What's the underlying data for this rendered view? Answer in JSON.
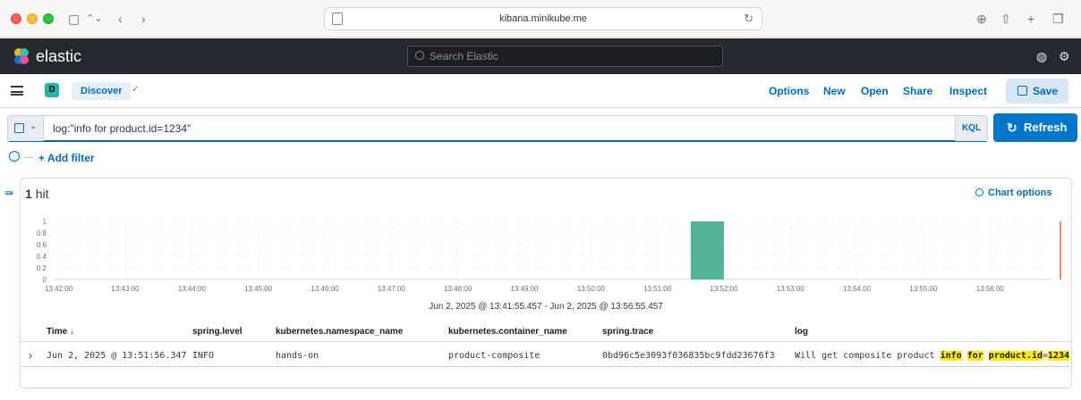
{
  "browser": {
    "url": "kibana.minikube.me",
    "icons": [
      "sidebar-icon",
      "tab-overview-icon",
      "back-icon",
      "forward-icon",
      "site-settings-icon",
      "reload-icon",
      "download-icon",
      "share-icon",
      "new-tab-icon",
      "tabs-icon"
    ]
  },
  "header": {
    "brand": "elastic",
    "search_placeholder": "Search Elastic",
    "icons": [
      "help-icon",
      "user-menu-icon"
    ]
  },
  "appbar": {
    "space_initial": "D",
    "breadcrumb": "Discover",
    "menu": [
      "Options",
      "New",
      "Open",
      "Share",
      "Inspect"
    ],
    "save_label": "Save"
  },
  "query": {
    "text": "log:\"info for product.id=1234\"",
    "language": "KQL",
    "refresh_label": "Refresh",
    "add_filter_label": "+ Add filter"
  },
  "results": {
    "hit_count": "1",
    "hit_label": "hit",
    "chart_options_label": "Chart options",
    "time_range": "Jun 2, 2025 @ 13:41:55.457 - Jun 2, 2025 @ 13:56:55.457"
  },
  "chart_data": {
    "type": "bar",
    "title": "",
    "xlabel": "Jun 2, 2025 @ 13:41:55.457 - Jun 2, 2025 @ 13:56:55.457",
    "ylabel": "",
    "x_ticks": [
      "13:42:00",
      "13:43:00",
      "13:44:00",
      "13:45:00",
      "13:46:00",
      "13:47:00",
      "13:48:00",
      "13:49:00",
      "13:50:00",
      "13:51:00",
      "13:52:00",
      "13:53:00",
      "13:54:00",
      "13:55:00",
      "13:56:00"
    ],
    "y_ticks": [
      "0",
      "0.2",
      "0.4",
      "0.6",
      "0.8",
      "1"
    ],
    "ylim": [
      0,
      1
    ],
    "bars": [
      {
        "start": "13:51:30",
        "end": "13:52:00",
        "value": 1
      }
    ],
    "bar_color": "#54b399",
    "now_marker_color": "#e7664c",
    "grid": true
  },
  "table": {
    "columns": [
      "Time",
      "spring.level",
      "kubernetes.namespace_name",
      "kubernetes.container_name",
      "spring.trace",
      "log"
    ],
    "rows": [
      {
        "time": "Jun 2, 2025 @ 13:51:56.347",
        "level": "INFO",
        "namespace": "hands-on",
        "container": "product-composite",
        "trace": "0bd96c5e3093f036835bc9fdd23676f3",
        "log_prefix": "Will get composite product ",
        "log_hl1": "info",
        "log_hl2": "for",
        "log_hl3": "product.id",
        "log_eq": "=",
        "log_hl4": "1234"
      }
    ]
  },
  "colors": {
    "header_bg": "#25282f",
    "accent": "#006bb8",
    "primary_button": "#0077cc",
    "highlight": "#ffea00"
  }
}
